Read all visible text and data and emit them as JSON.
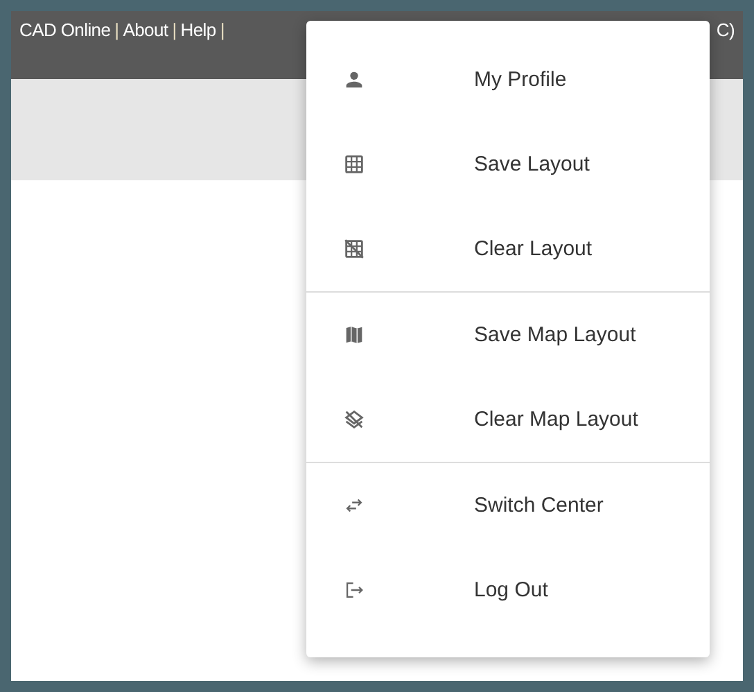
{
  "header": {
    "items": [
      {
        "kind": "link",
        "text": "CAD Online"
      },
      {
        "kind": "separator",
        "text": "|"
      },
      {
        "kind": "link",
        "text": "About"
      },
      {
        "kind": "separator",
        "text": "|"
      },
      {
        "kind": "link",
        "text": "Help"
      },
      {
        "kind": "separator",
        "text": "|"
      }
    ],
    "tail": "C)"
  },
  "menu": {
    "sections": [
      {
        "items": [
          {
            "kind": "person",
            "label": "My Profile"
          },
          {
            "kind": "grid",
            "label": "Save Layout"
          },
          {
            "kind": "gridoff",
            "label": "Clear Layout"
          }
        ]
      },
      {
        "items": [
          {
            "kind": "map",
            "label": "Save Map Layout"
          },
          {
            "kind": "layersoff",
            "label": "Clear Map Layout"
          }
        ]
      },
      {
        "items": [
          {
            "kind": "swap",
            "label": "Switch Center"
          },
          {
            "kind": "logout",
            "label": "Log Out"
          }
        ]
      }
    ]
  }
}
